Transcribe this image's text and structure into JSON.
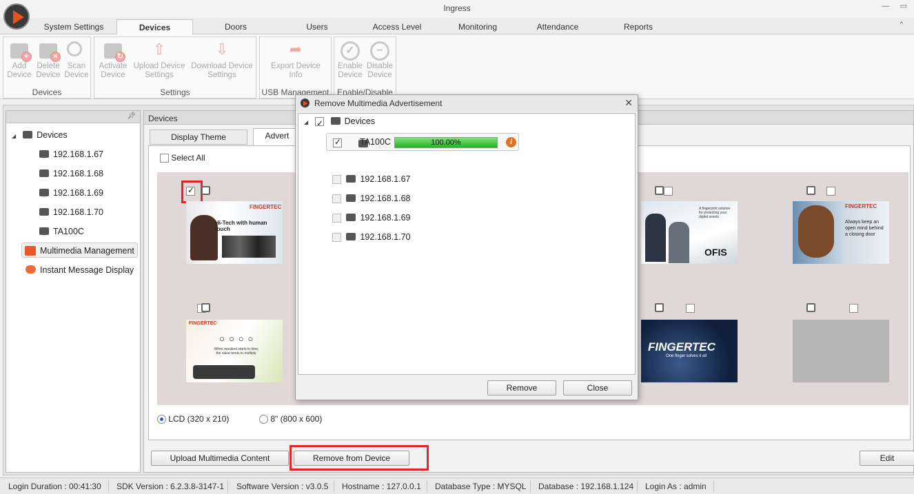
{
  "app": {
    "title": "Ingress"
  },
  "tabs": [
    "System Settings",
    "Devices",
    "Doors",
    "Users",
    "Access Level",
    "Monitoring",
    "Attendance",
    "Reports"
  ],
  "active_tab": "Devices",
  "ribbon": {
    "groups": [
      {
        "label": "Devices",
        "buttons": [
          [
            "Add",
            "Device"
          ],
          [
            "Delete",
            "Device"
          ],
          [
            "Scan",
            "Device"
          ]
        ]
      },
      {
        "label": "Settings",
        "buttons": [
          [
            "Activate",
            "Device"
          ],
          [
            "Upload Device",
            "Settings"
          ],
          [
            "Download Device",
            "Settings"
          ]
        ]
      },
      {
        "label": "USB Management",
        "buttons": [
          [
            "Export Device",
            "Info"
          ]
        ]
      },
      {
        "label": "Enable/Disable",
        "buttons": [
          [
            "Enable",
            "Device"
          ],
          [
            "Disable",
            "Device"
          ]
        ]
      }
    ]
  },
  "tree": {
    "root": "Devices",
    "devices": [
      "192.168.1.67",
      "192.168.1.68",
      "192.168.1.69",
      "192.168.1.70",
      "TA100C"
    ],
    "multimedia": "Multimedia Management",
    "instant_message": "Instant Message Display"
  },
  "right_panel": {
    "title": "Devices",
    "subtabs": [
      "Display Theme",
      "Advert"
    ],
    "select_all": "Select All",
    "thumb1_heading": "Hi-Tech with human touch",
    "thumb_brand": "FINGERTEC",
    "thumb_ofis_text": "OFIS",
    "thumb_ofis_tag": "A fingerprint solution for protecting your digital assets",
    "thumb_bear_text": "Always keep an open mind behind a closing door",
    "thumb_mankind_text": "When mankind starts to time, the value tends to multiply.",
    "thumb_logo_tag": "One finger solves it all",
    "radio_lcd": "LCD (320 x 210)",
    "radio_8in": "8\" (800 x 600)",
    "upload_btn": "Upload Multimedia Content",
    "remove_btn": "Remove from Device",
    "edit_btn": "Edit"
  },
  "dialog": {
    "title": "Remove Multimedia Advertisement",
    "root": "Devices",
    "target_device": "TA100C",
    "progress": "100.00%",
    "progress_value": 100,
    "other_devices": [
      "192.168.1.67",
      "192.168.1.68",
      "192.168.1.69",
      "192.168.1.70"
    ],
    "remove_btn": "Remove",
    "close_btn": "Close"
  },
  "status": {
    "login_duration": "Login Duration : 00:41:30",
    "sdk": "SDK Version : 6.2.3.8-3147-1",
    "software": "Software Version : v3.0.5",
    "hostname": "Hostname : 127.0.0.1",
    "db_type": "Database Type : MYSQL",
    "database": "Database : 192.168.1.124",
    "login_as": "Login As : admin"
  },
  "colors": {
    "accent": "#e9541c",
    "highlight_box": "#e3242b",
    "progress": "#22b422"
  }
}
